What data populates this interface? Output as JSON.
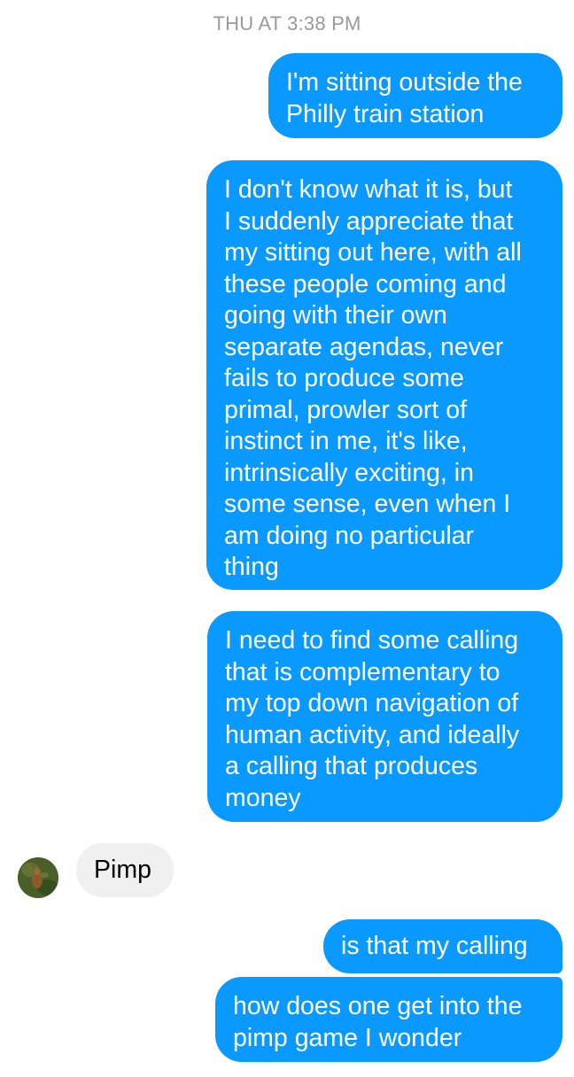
{
  "conversation": {
    "timestamp": "THU AT 3:38 PM",
    "messages": [
      {
        "sender": "me",
        "text": "I'm sitting outside the\nPhilly train station"
      },
      {
        "sender": "me",
        "text": "I don't know what it is, but\nI suddenly appreciate that\nmy sitting out here, with all\nthese people coming and\ngoing with their own\nseparate agendas, never\nfails to produce some\nprimal, prowler sort of\ninstinct in me, it's like,\nintrinsically exciting, in\nsome sense, even when I\nam doing no particular\nthing"
      },
      {
        "sender": "me",
        "text": "I need to find some calling\nthat is complementary to\nmy top down navigation of\nhuman activity, and ideally\na calling that produces\nmoney"
      },
      {
        "sender": "them",
        "text": "Pimp"
      },
      {
        "sender": "me",
        "text": "is that my calling"
      },
      {
        "sender": "me",
        "text": "how does one get into the\npimp game I wonder"
      }
    ]
  },
  "colors": {
    "outgoing_bubble": "#0a99ff",
    "incoming_bubble": "#f1f0f0",
    "timestamp_text": "#9a9a9a"
  },
  "icons": {
    "avatar": "contact-avatar-photo"
  }
}
